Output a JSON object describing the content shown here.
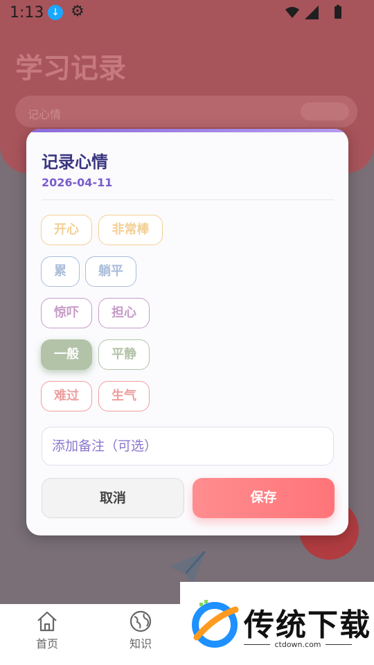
{
  "status_bar": {
    "time": "1:13"
  },
  "background_app": {
    "title": "学习记录",
    "search_placeholder": "记心情",
    "nav": [
      {
        "label": "首页",
        "icon": "home-icon"
      },
      {
        "label": "知识",
        "icon": "globe-icon"
      }
    ]
  },
  "dialog": {
    "title": "记录心情",
    "date": "2026-04-11",
    "moods": [
      {
        "label": "开心",
        "color": "#f3cf93",
        "selected": false
      },
      {
        "label": "非常棒",
        "color": "#f3cf93",
        "selected": false
      },
      {
        "label": "累",
        "color": "#a9bcd8",
        "selected": false
      },
      {
        "label": "躺平",
        "color": "#a9bcd8",
        "selected": false
      },
      {
        "label": "惊吓",
        "color": "#c79bc6",
        "selected": false
      },
      {
        "label": "担心",
        "color": "#c79bc6",
        "selected": false
      },
      {
        "label": "一般",
        "color": "#b2c3a8",
        "selected": true
      },
      {
        "label": "平静",
        "color": "#b2c3a8",
        "selected": false
      },
      {
        "label": "难过",
        "color": "#ee9e9e",
        "selected": false
      },
      {
        "label": "生气",
        "color": "#ee9e9e",
        "selected": false
      }
    ],
    "note_placeholder": "添加备注（可选）",
    "cancel_label": "取消",
    "save_label": "保存"
  },
  "watermark": {
    "name": "传统下载",
    "url": "ctdown.com"
  }
}
